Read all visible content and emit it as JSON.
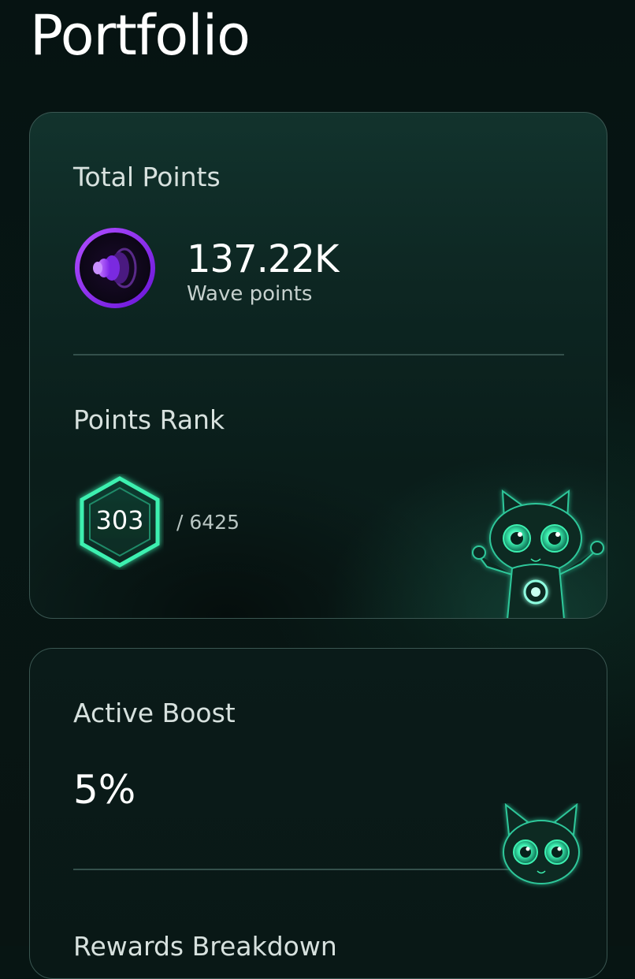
{
  "page": {
    "title": "Portfolio"
  },
  "total_points": {
    "label": "Total Points",
    "value": "137.22K",
    "unit": "Wave points",
    "icon": "wave-points-icon"
  },
  "rank": {
    "label": "Points Rank",
    "value": "303",
    "total": "/ 6425",
    "icon": "hexagon-badge-icon"
  },
  "boost": {
    "label": "Active Boost",
    "value": "5%"
  },
  "rewards": {
    "label": "Rewards Breakdown"
  },
  "colors": {
    "background": "#071513",
    "card_border": "#3a5651",
    "accent_green": "#3cf0b0",
    "accent_purple": "#8b2cf5"
  }
}
